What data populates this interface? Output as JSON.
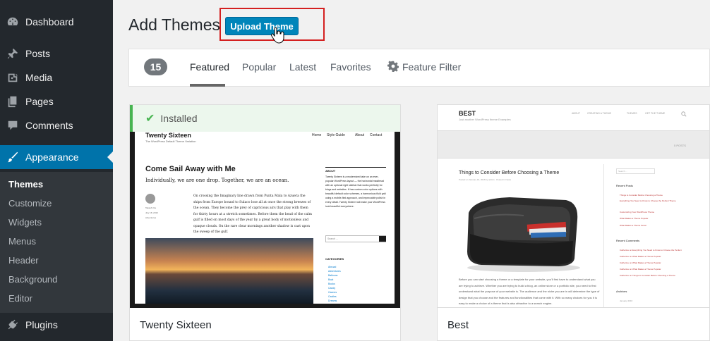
{
  "sidebar": {
    "items": [
      {
        "label": "Dashboard",
        "icon": "dashboard-icon"
      },
      {
        "label": "Posts",
        "icon": "pushpin-icon"
      },
      {
        "label": "Media",
        "icon": "media-icon"
      },
      {
        "label": "Pages",
        "icon": "pages-icon"
      },
      {
        "label": "Comments",
        "icon": "comment-icon"
      },
      {
        "label": "Appearance",
        "icon": "paintbrush-icon"
      },
      {
        "label": "Plugins",
        "icon": "plugin-icon"
      }
    ],
    "submenu": [
      "Themes",
      "Customize",
      "Widgets",
      "Menus",
      "Header",
      "Background",
      "Editor"
    ]
  },
  "header": {
    "title": "Add Themes",
    "upload_button": "Upload Theme"
  },
  "filter_bar": {
    "count": "15",
    "tabs": [
      "Featured",
      "Popular",
      "Latest",
      "Favorites"
    ],
    "feature_filter": "Feature Filter",
    "active_tab": "Featured"
  },
  "themes": [
    {
      "name": "Twenty Sixteen",
      "installed_label": "Installed",
      "preview": {
        "site_title": "Twenty Sixteen",
        "tagline": "The WordPress Default Theme Variation",
        "nav": [
          "Home",
          "Style Guide",
          "About",
          "Contact"
        ],
        "post_title": "Come Sail Away with Me",
        "post_subtitle": "Individually, we are one drop. Together, we are an ocean.",
        "author": "Takashi Irie",
        "date": "July 18, 2016",
        "category": "Adventures",
        "body": "On crossing the Imaginary line drawn from Punta Mala to Azuera the ships from Europe bound to Sulaco lose all at once the strong breezes of the ocean. They become the prey of capricious airs that play with them for thirty hours at a stretch sometimes. Before them the head of the calm gulf is filled on most days of the year by a great body of motionless and opaque clouds. On the rare clear mornings another shadow is cast upon the sweep of the gulf.",
        "about_heading": "ABOUT",
        "about_text": "Twenty Sixteen is a modernized take on an ever-popular WordPress layout — the horizontal masthead with an optional right sidebar that works perfectly for blogs and websites. It has custom color options with beautiful default color schemes, a harmonious fluid grid using a mobile-first approach, and impeccable polish in every detail. Twenty Sixteen will make your WordPress look beautiful everywhere.",
        "search_placeholder": "Search ...",
        "categories_heading": "CATEGORIES",
        "categories": [
          "Abroad",
          "Adventures",
          "Balloons",
          "Boat",
          "Books",
          "Candy",
          "Cannes",
          "Castles",
          "Dreams"
        ]
      }
    },
    {
      "name": "Best",
      "preview": {
        "site_title": "BEST",
        "tagline": "Just another WordPress theme Examples",
        "nav": [
          "ABOUT",
          "CREATING A THEME",
          "THEMES",
          "GET THE THEME"
        ],
        "posts_label": "5 POSTS",
        "post_title": "Things to Consider Before Choosing a Theme",
        "post_meta": "Posted on January 19, 2016 by admin · Posted in News",
        "body": "Before you can start choosing a theme or a template for your website, you'll first have to understand what you are trying to achieve. Whether you are trying to build a blog, an online store or a portfolio site, you need to first understand what the purpose of your website is. The audience and the niche you are in will determine the type of design that you choose and the features and functionalities that come with it. With so many choices for you it is easy to make a choice of a theme that is also attractive to a search engine.",
        "search_placeholder": "Search ...",
        "recent_posts_heading": "Recent Posts",
        "recent_posts": [
          "Things to Consider Before Choosing a Theme",
          "Everything You Need to Know to Choose the Perfect Theme",
          "Customizing Your WordPress Theme",
          "What Makes a Theme Popular",
          "What Makes a Theme Great"
        ],
        "recent_comments_heading": "Recent Comments",
        "recent_comments": [
          "Catherine on Everything You Need to Know to Choose the Perfect",
          "Catherine on What Makes a Theme Popular",
          "Catherine on What Makes a Theme Popular",
          "Catherine on What Makes a Theme Popular",
          "Catherine on Things to Consider Before Choosing a Theme"
        ],
        "archives_heading": "Archives",
        "archives": [
          "January 2016"
        ]
      }
    }
  ]
}
